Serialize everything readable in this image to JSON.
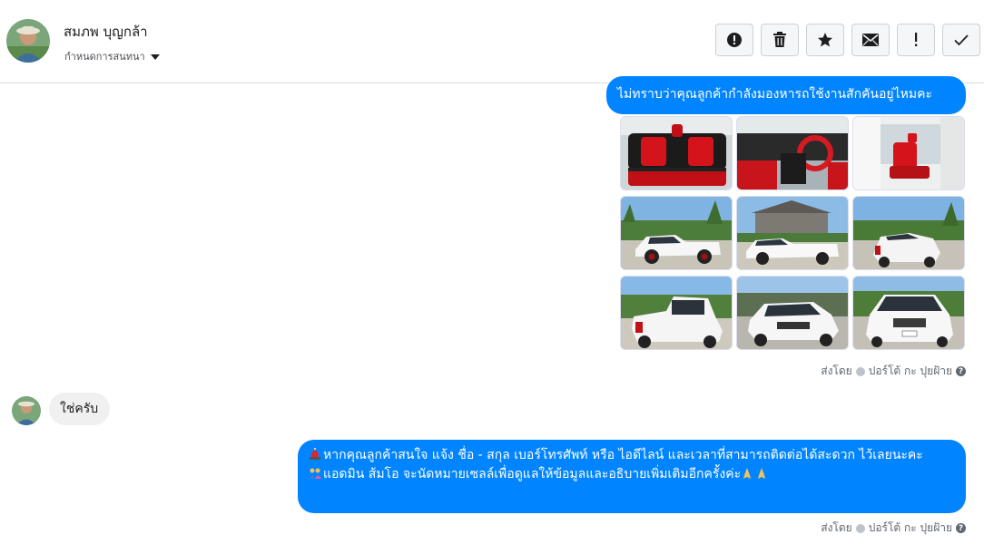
{
  "header": {
    "contact_name": "สมภพ บุญกล้า",
    "assign_label": "กำหนดการสนทนา",
    "actions": [
      {
        "name": "report-spam",
        "icon": "alert-circle-icon"
      },
      {
        "name": "delete",
        "icon": "trash-icon"
      },
      {
        "name": "star",
        "icon": "star-icon"
      },
      {
        "name": "mark-unread",
        "icon": "envelope-icon"
      },
      {
        "name": "follow-up",
        "icon": "exclamation-icon"
      },
      {
        "name": "mark-done",
        "icon": "checkmark-icon"
      }
    ]
  },
  "messages": {
    "m1_text": "ไม่ทราบว่าคุณลูกค้ากำลังมองหารถใช้งานสักคันอยู่ไหมคะ",
    "photos": [
      "car-interior-rear-seats-photo",
      "car-interior-dashboard-photo",
      "car-interior-front-seat-photo",
      "white-pickup-side-photo",
      "white-pickup-side-house-photo",
      "white-pickup-rear-three-quarter-photo",
      "white-pickup-rear-photo",
      "white-pickup-front-three-quarter-photo",
      "white-pickup-front-photo"
    ],
    "sent_by_prefix": "ส่งโดย",
    "sent_by_name": "ปอร์โต้ กะ ปุยฝ้าย",
    "reply_text": "ใช่ครับ",
    "m2_line1": "หากคุณลูกค้าสนใจ แจ้ง ชื่อ - สกุล เบอร์โทรศัพท์ หรือ ไอดีไลน์ และเวลาที่สามารถติดต่อได้สะดวก ไว้เลยนะคะ",
    "m2_line2": "แอดมิน ส้มโอ จะนัดหมายเซลล์เพื่อดูแลให้ข้อมูลและอธิบายเพิ่มเติมอีกครั้งค่ะ"
  },
  "colors": {
    "outgoing_bubble": "#0084ff",
    "incoming_bubble": "#f1f0f0"
  }
}
